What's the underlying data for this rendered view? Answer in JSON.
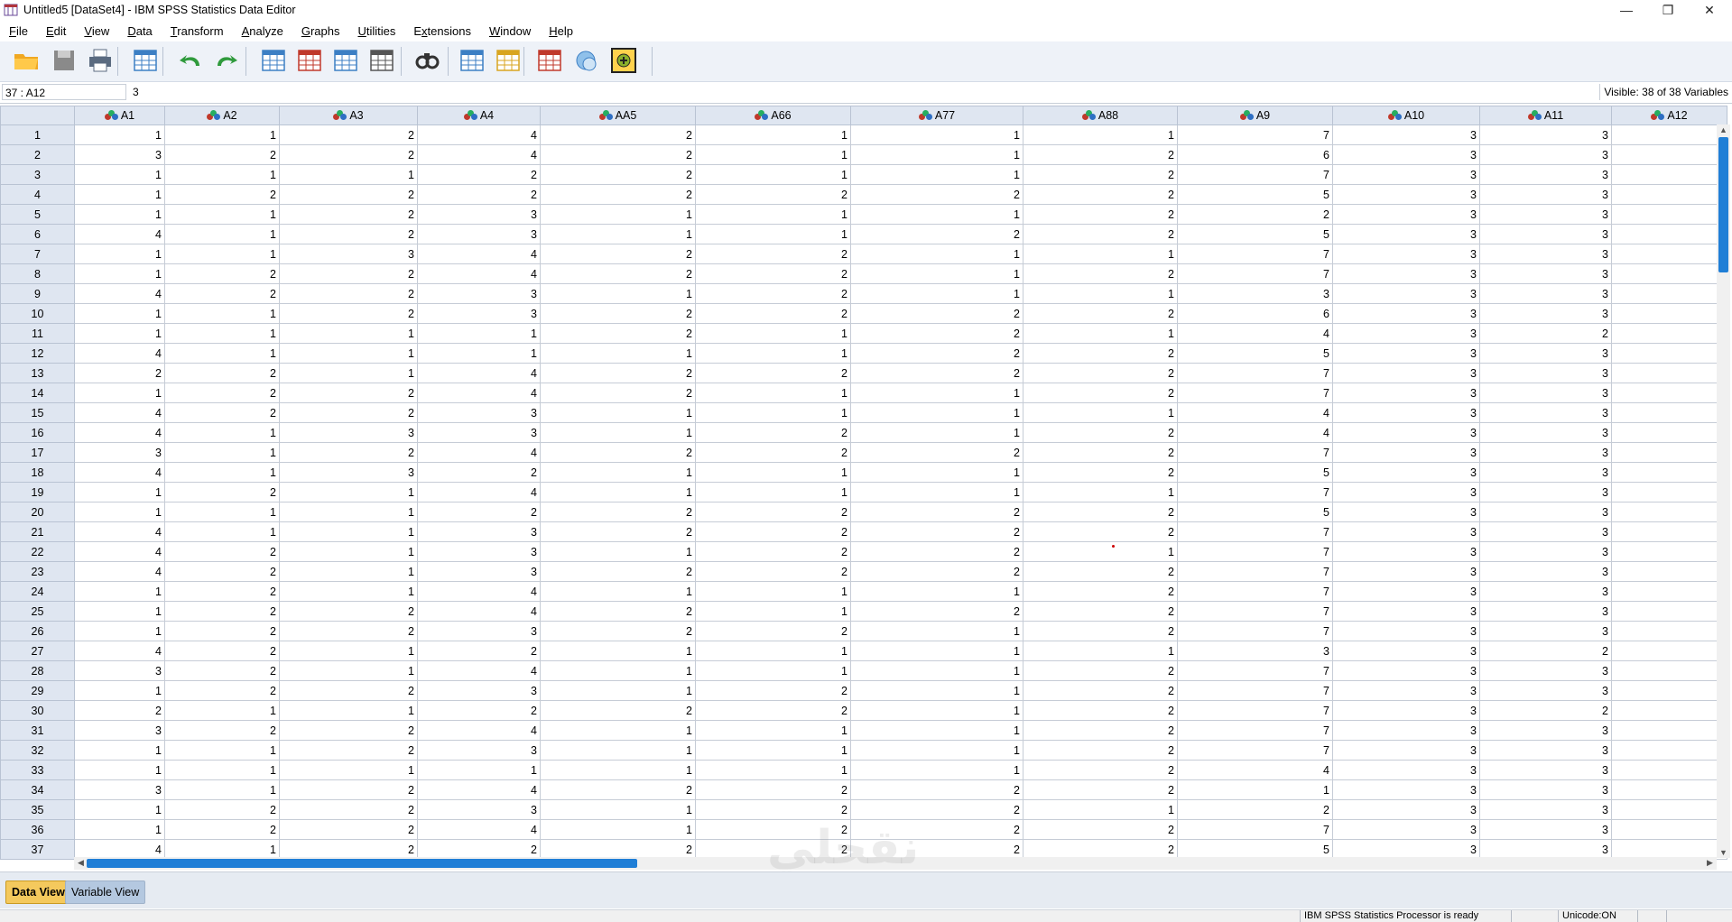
{
  "window": {
    "title": "Untitled5 [DataSet4] - IBM SPSS Statistics Data Editor",
    "controls": {
      "minimize": "—",
      "restore": "❐",
      "close": "✕"
    }
  },
  "menu": [
    {
      "pre": "",
      "mn": "F",
      "post": "ile"
    },
    {
      "pre": "",
      "mn": "E",
      "post": "dit"
    },
    {
      "pre": "",
      "mn": "V",
      "post": "iew"
    },
    {
      "pre": "",
      "mn": "D",
      "post": "ata"
    },
    {
      "pre": "",
      "mn": "T",
      "post": "ransform"
    },
    {
      "pre": "",
      "mn": "A",
      "post": "nalyze"
    },
    {
      "pre": "",
      "mn": "G",
      "post": "raphs"
    },
    {
      "pre": "",
      "mn": "U",
      "post": "tilities"
    },
    {
      "pre": "E",
      "mn": "x",
      "post": "tensions"
    },
    {
      "pre": "",
      "mn": "W",
      "post": "indow"
    },
    {
      "pre": "",
      "mn": "H",
      "post": "elp"
    }
  ],
  "toolbar": [
    {
      "name": "open-folder-icon",
      "color": "#f0a822"
    },
    {
      "name": "save-icon",
      "color": "#8a8a8a"
    },
    {
      "name": "print-icon",
      "color": "#5b6b80"
    },
    {
      "name": "recall-dialog-icon",
      "color": "#3c7fc4"
    },
    {
      "name": "undo-icon",
      "color": "#2f9a3c"
    },
    {
      "name": "redo-icon",
      "color": "#2f9a3c"
    },
    {
      "name": "goto-case-icon",
      "color": "#3c7fc4"
    },
    {
      "name": "goto-variable-icon",
      "color": "#c0392b"
    },
    {
      "name": "variables-icon",
      "color": "#3c7fc4"
    },
    {
      "name": "run-descriptives-icon",
      "color": "#555555"
    },
    {
      "name": "find-icon",
      "color": "#333333"
    },
    {
      "name": "insert-cases-icon",
      "color": "#3c7fc4"
    },
    {
      "name": "insert-variable-icon",
      "color": "#d8a520"
    },
    {
      "name": "split-file-icon",
      "color": "#c0392b"
    },
    {
      "name": "use-sets-icon",
      "color": "#3c7fc4"
    },
    {
      "name": "spelling-icon",
      "color": "#8ab02a"
    }
  ],
  "cellbar": {
    "cell_ref": "37 : A12",
    "cell_value": "3",
    "visible_variables": "Visible: 38 of 38 Variables"
  },
  "columns": [
    "A1",
    "A2",
    "A3",
    "A4",
    "AA5",
    "A66",
    "A77",
    "A88",
    "A9",
    "A10",
    "A11",
    "A12"
  ],
  "rows": [
    [
      "1",
      "1",
      "1",
      "2",
      "4",
      "2",
      "1",
      "1",
      "1",
      "7",
      "3",
      "3",
      ""
    ],
    [
      "2",
      "3",
      "2",
      "2",
      "4",
      "2",
      "1",
      "1",
      "2",
      "6",
      "3",
      "3",
      ""
    ],
    [
      "3",
      "1",
      "1",
      "1",
      "2",
      "2",
      "1",
      "1",
      "2",
      "7",
      "3",
      "3",
      ""
    ],
    [
      "4",
      "1",
      "2",
      "2",
      "2",
      "2",
      "2",
      "2",
      "2",
      "5",
      "3",
      "3",
      ""
    ],
    [
      "5",
      "1",
      "1",
      "2",
      "3",
      "1",
      "1",
      "1",
      "2",
      "2",
      "3",
      "3",
      ""
    ],
    [
      "6",
      "4",
      "1",
      "2",
      "3",
      "1",
      "1",
      "2",
      "2",
      "5",
      "3",
      "3",
      ""
    ],
    [
      "7",
      "1",
      "1",
      "3",
      "4",
      "2",
      "2",
      "1",
      "1",
      "7",
      "3",
      "3",
      ""
    ],
    [
      "8",
      "1",
      "2",
      "2",
      "4",
      "2",
      "2",
      "1",
      "2",
      "7",
      "3",
      "3",
      ""
    ],
    [
      "9",
      "4",
      "2",
      "2",
      "3",
      "1",
      "2",
      "1",
      "1",
      "3",
      "3",
      "3",
      ""
    ],
    [
      "10",
      "1",
      "1",
      "2",
      "3",
      "2",
      "2",
      "2",
      "2",
      "6",
      "3",
      "3",
      ""
    ],
    [
      "11",
      "1",
      "1",
      "1",
      "1",
      "2",
      "1",
      "2",
      "1",
      "4",
      "3",
      "2",
      ""
    ],
    [
      "12",
      "4",
      "1",
      "1",
      "1",
      "1",
      "1",
      "2",
      "2",
      "5",
      "3",
      "3",
      ""
    ],
    [
      "13",
      "2",
      "2",
      "1",
      "4",
      "2",
      "2",
      "2",
      "2",
      "7",
      "3",
      "3",
      ""
    ],
    [
      "14",
      "1",
      "2",
      "2",
      "4",
      "2",
      "1",
      "1",
      "2",
      "7",
      "3",
      "3",
      ""
    ],
    [
      "15",
      "4",
      "2",
      "2",
      "3",
      "1",
      "1",
      "1",
      "1",
      "4",
      "3",
      "3",
      ""
    ],
    [
      "16",
      "4",
      "1",
      "3",
      "3",
      "1",
      "2",
      "1",
      "2",
      "4",
      "3",
      "3",
      ""
    ],
    [
      "17",
      "3",
      "1",
      "2",
      "4",
      "2",
      "2",
      "2",
      "2",
      "7",
      "3",
      "3",
      ""
    ],
    [
      "18",
      "4",
      "1",
      "3",
      "2",
      "1",
      "1",
      "1",
      "2",
      "5",
      "3",
      "3",
      ""
    ],
    [
      "19",
      "1",
      "2",
      "1",
      "4",
      "1",
      "1",
      "1",
      "1",
      "7",
      "3",
      "3",
      ""
    ],
    [
      "20",
      "1",
      "1",
      "1",
      "2",
      "2",
      "2",
      "2",
      "2",
      "5",
      "3",
      "3",
      ""
    ],
    [
      "21",
      "4",
      "1",
      "1",
      "3",
      "2",
      "2",
      "2",
      "2",
      "7",
      "3",
      "3",
      ""
    ],
    [
      "22",
      "4",
      "2",
      "1",
      "3",
      "1",
      "2",
      "2",
      "1",
      "7",
      "3",
      "3",
      ""
    ],
    [
      "23",
      "4",
      "2",
      "1",
      "3",
      "2",
      "2",
      "2",
      "2",
      "7",
      "3",
      "3",
      ""
    ],
    [
      "24",
      "1",
      "2",
      "1",
      "4",
      "1",
      "1",
      "1",
      "2",
      "7",
      "3",
      "3",
      ""
    ],
    [
      "25",
      "1",
      "2",
      "2",
      "4",
      "2",
      "1",
      "2",
      "2",
      "7",
      "3",
      "3",
      ""
    ],
    [
      "26",
      "1",
      "2",
      "2",
      "3",
      "2",
      "2",
      "1",
      "2",
      "7",
      "3",
      "3",
      ""
    ],
    [
      "27",
      "4",
      "2",
      "1",
      "2",
      "1",
      "1",
      "1",
      "1",
      "3",
      "3",
      "2",
      ""
    ],
    [
      "28",
      "3",
      "2",
      "1",
      "4",
      "1",
      "1",
      "1",
      "2",
      "7",
      "3",
      "3",
      ""
    ],
    [
      "29",
      "1",
      "2",
      "2",
      "3",
      "1",
      "2",
      "1",
      "2",
      "7",
      "3",
      "3",
      ""
    ],
    [
      "30",
      "2",
      "1",
      "1",
      "2",
      "2",
      "2",
      "1",
      "2",
      "7",
      "3",
      "2",
      ""
    ],
    [
      "31",
      "3",
      "2",
      "2",
      "4",
      "1",
      "1",
      "1",
      "2",
      "7",
      "3",
      "3",
      ""
    ],
    [
      "32",
      "1",
      "1",
      "2",
      "3",
      "1",
      "1",
      "1",
      "2",
      "7",
      "3",
      "3",
      ""
    ],
    [
      "33",
      "1",
      "1",
      "1",
      "1",
      "1",
      "1",
      "1",
      "2",
      "4",
      "3",
      "3",
      ""
    ],
    [
      "34",
      "3",
      "1",
      "2",
      "4",
      "2",
      "2",
      "2",
      "2",
      "1",
      "3",
      "3",
      ""
    ],
    [
      "35",
      "1",
      "2",
      "2",
      "3",
      "1",
      "2",
      "2",
      "1",
      "2",
      "3",
      "3",
      ""
    ],
    [
      "36",
      "1",
      "2",
      "2",
      "4",
      "1",
      "2",
      "2",
      "2",
      "7",
      "3",
      "3",
      ""
    ],
    [
      "37",
      "4",
      "1",
      "2",
      "2",
      "2",
      "2",
      "2",
      "2",
      "5",
      "3",
      "3",
      ""
    ]
  ],
  "tabs": {
    "data_view": "Data View",
    "variable_view": "Variable View"
  },
  "status": {
    "processor": "IBM SPSS Statistics Processor is ready",
    "unicode": "Unicode:ON"
  },
  "watermark": "نقحلي",
  "colors": {
    "header_bg": "#dfe6f1",
    "accent_blue": "#1f7ed6",
    "active_tab": "#f4c95d"
  }
}
